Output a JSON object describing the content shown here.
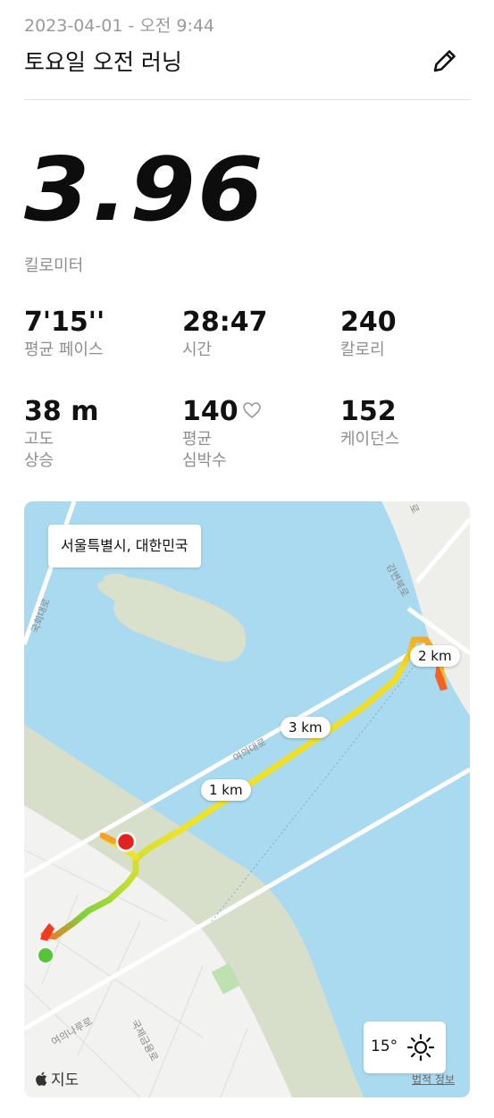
{
  "header": {
    "date": "2023-04-01 - 오전 9:44",
    "title": "토요일 오전 러닝",
    "edit_icon": "pencil-icon"
  },
  "distance": {
    "value": "3.96",
    "unit": "킬로미터"
  },
  "stats": [
    {
      "value": "7'15''",
      "label": "평균 페이스"
    },
    {
      "value": "28:47",
      "label": "시간"
    },
    {
      "value": "240",
      "label": "칼로리"
    },
    {
      "value": "38 m",
      "label": "고도\n상승"
    },
    {
      "value": "140",
      "label": "평균\n심박수",
      "icon": "heart-icon"
    },
    {
      "value": "152",
      "label": "케이던스"
    }
  ],
  "map": {
    "location_label": "서울특별시, 대한민국",
    "km_markers": [
      "1 km",
      "2 km",
      "3 km"
    ],
    "road_labels": [
      "국회대로",
      "여의대로",
      "여의나루로",
      "국제금융로",
      "강변북로",
      "로"
    ],
    "weather": {
      "temperature": "15°",
      "icon": "sun-icon"
    },
    "maps_logo": "지도",
    "legal": "법적 정보",
    "colors": {
      "water": "#a9daf0",
      "park": "#d7dfca",
      "land": "#f0f0ee",
      "route_slow": "#f4752a",
      "route_mid": "#f0e22a",
      "route_fast": "#7ed13a",
      "start": "#55c437",
      "end": "#e3221f"
    }
  }
}
